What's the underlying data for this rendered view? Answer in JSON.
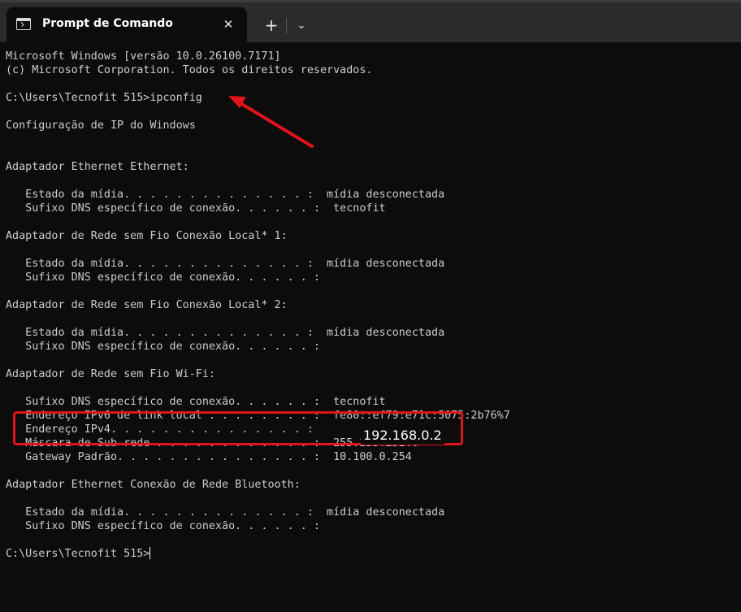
{
  "window": {
    "tab_title": "Prompt de Comando",
    "tab_close_glyph": "✕",
    "new_tab_glyph": "+",
    "dropdown_glyph": "⌄"
  },
  "colors": {
    "background": "#0c0c0c",
    "titlebar": "#2b2b2b",
    "text": "#cccccc",
    "annotation_red": "#e0141b"
  },
  "console": {
    "lines": [
      "Microsoft Windows [versão 10.0.26100.7171]",
      "(c) Microsoft Corporation. Todos os direitos reservados.",
      "",
      "C:\\Users\\Tecnofit 515>ipconfig",
      "",
      "Configuração de IP do Windows",
      "",
      "",
      "Adaptador Ethernet Ethernet:",
      "",
      "   Estado da mídia. . . . . . . . . . . . . . :  mídia desconectada",
      "   Sufixo DNS específico de conexão. . . . . . :  tecnofit",
      "",
      "Adaptador de Rede sem Fio Conexão Local* 1:",
      "",
      "   Estado da mídia. . . . . . . . . . . . . . :  mídia desconectada",
      "   Sufixo DNS específico de conexão. . . . . . :",
      "",
      "Adaptador de Rede sem Fio Conexão Local* 2:",
      "",
      "   Estado da mídia. . . . . . . . . . . . . . :  mídia desconectada",
      "   Sufixo DNS específico de conexão. . . . . . :",
      "",
      "Adaptador de Rede sem Fio Wi-Fi:",
      "",
      "   Sufixo DNS específico de conexão. . . . . . :  tecnofit",
      "   Endereço IPv6 de link local . . . . . . . . :  fe80::ef79:e71c:5075:2b76%7",
      "   Endereço IPv4. . . . . . . . . . . . . . . :",
      "   Máscara de Sub-rede . . . . . . . . . . . . :  255.255.252.0",
      "   Gateway Padrão. . . . . . . . . . . . . . . :  10.100.0.254",
      "",
      "Adaptador Ethernet Conexão de Rede Bluetooth:",
      "",
      "   Estado da mídia. . . . . . . . . . . . . . :  mídia desconectada",
      "   Sufixo DNS específico de conexão. . . . . . :",
      "",
      "C:\\Users\\Tecnofit 515>"
    ]
  },
  "annotations": {
    "ipv4_value": "192.168.0.2"
  }
}
